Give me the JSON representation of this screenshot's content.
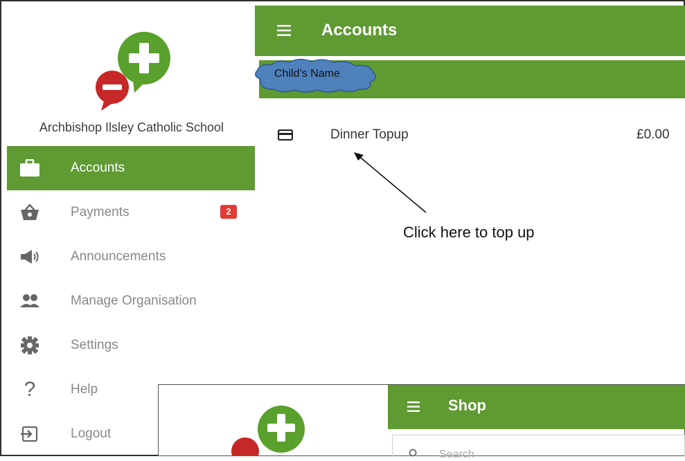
{
  "sidebar": {
    "school_name": "Archbishop Ilsley Catholic School",
    "items": [
      {
        "label": "Accounts",
        "icon": "briefcase-icon",
        "active": true
      },
      {
        "label": "Payments",
        "icon": "basket-icon",
        "badge": "2"
      },
      {
        "label": "Announcements",
        "icon": "megaphone-icon"
      },
      {
        "label": "Manage Organisation",
        "icon": "people-icon"
      },
      {
        "label": "Settings",
        "icon": "gear-icon"
      },
      {
        "label": "Help",
        "icon": "help-icon"
      },
      {
        "label": "Logout",
        "icon": "logout-icon"
      }
    ]
  },
  "header": {
    "title": "Accounts"
  },
  "subheader": {
    "child_name": "Child’s Name"
  },
  "accounts": [
    {
      "label": "Dinner Topup",
      "amount": "£0.00",
      "icon": "card-icon"
    }
  ],
  "annotation": {
    "text": "Click here to top up"
  },
  "overlay": {
    "title": "Shop",
    "search_placeholder": "Search"
  },
  "colors": {
    "accent": "#5f9a32",
    "badge": "#e53935",
    "logo_green": "#5aa02c",
    "logo_red": "#c62828",
    "cloud": "#4f81bd"
  }
}
